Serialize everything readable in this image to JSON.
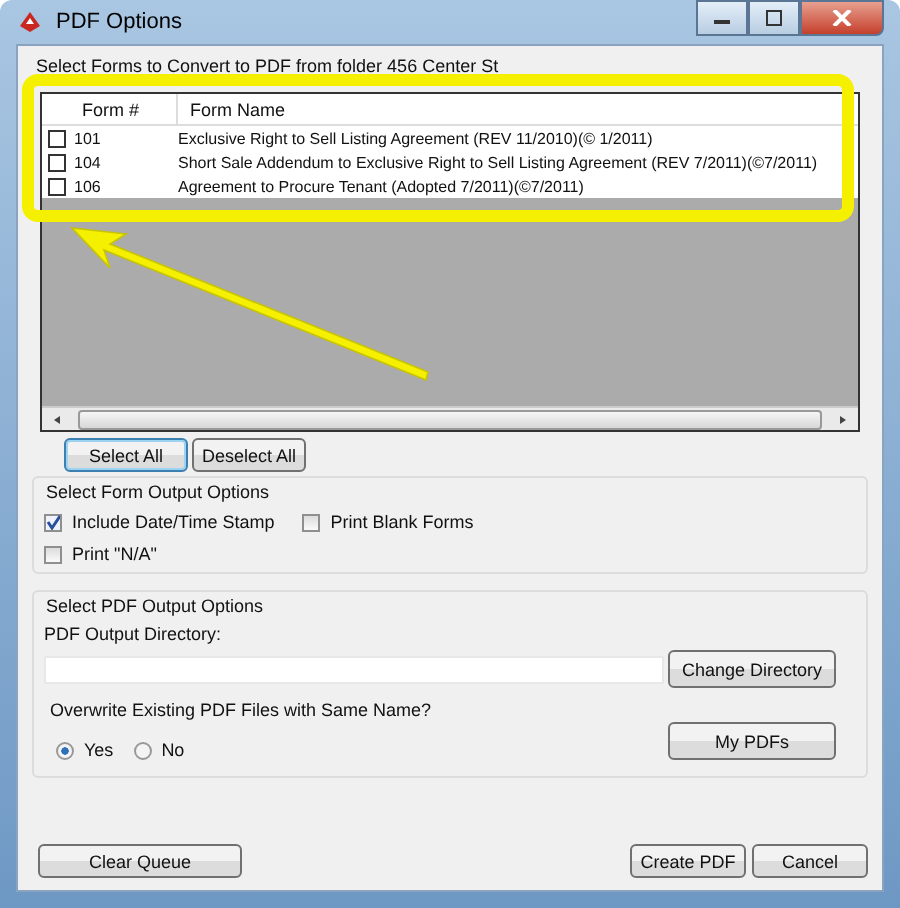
{
  "window": {
    "title": "PDF Options"
  },
  "forms_section": {
    "label": "Select Forms to Convert to PDF from folder 456 Center St"
  },
  "forms_table": {
    "columns": [
      "Form #",
      "Form Name"
    ],
    "rows": [
      {
        "number": "101",
        "name": "Exclusive Right to Sell Listing Agreement (REV 11/2010)(© 1/2011)",
        "checked": false
      },
      {
        "number": "104",
        "name": "Short Sale Addendum to Exclusive Right to Sell Listing Agreement (REV 7/2011)(©7/2011)",
        "checked": false
      },
      {
        "number": "106",
        "name": "Agreement to Procure Tenant (Adopted 7/2011)(©7/2011)",
        "checked": false
      }
    ]
  },
  "selection_buttons": [
    "Select All",
    "Deselect All"
  ],
  "form_output": {
    "label": "Select Form Output Options",
    "options": [
      {
        "label": "Include Date/Time Stamp",
        "checked": true
      },
      {
        "label": "Print Blank Forms",
        "checked": false
      },
      {
        "label": "Print \"N/A\"",
        "checked": false
      }
    ]
  },
  "pdf_output": {
    "label": "Select PDF Output Options",
    "directory_label": "PDF Output Directory:",
    "change_button": "Change Directory",
    "overwrite_label": "Overwrite Existing PDF Files with Same Name?",
    "overwrite_options": [
      {
        "label": "Yes",
        "selected": true
      },
      {
        "label": "No",
        "selected": false
      }
    ],
    "my_pdfs_button": "My PDFs"
  },
  "footer_buttons": {
    "left": [
      "Clear Queue"
    ],
    "right": [
      "Create PDF",
      "Cancel"
    ]
  }
}
